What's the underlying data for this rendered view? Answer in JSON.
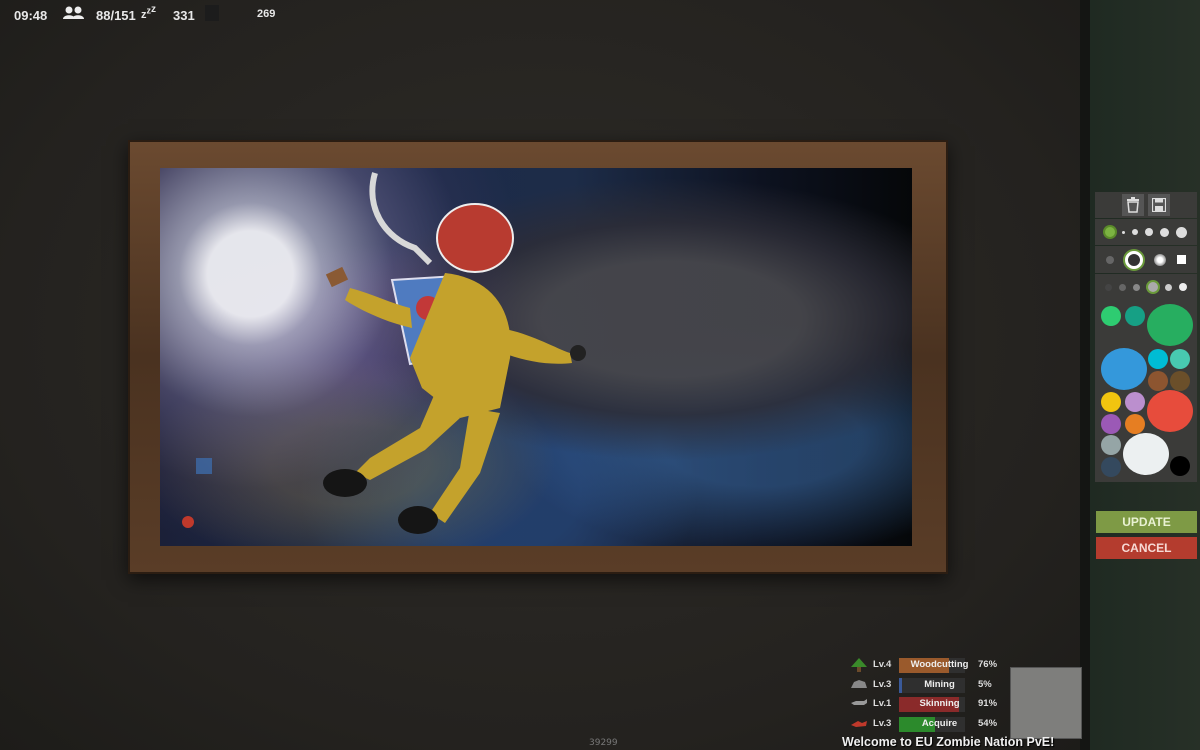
{
  "hud": {
    "time": "09:48",
    "players": "88/151",
    "sleepers_icon": "zzz",
    "sleepers": "331",
    "counter": "269"
  },
  "sign_painter": {
    "tools": {
      "delete_icon": "trash-icon",
      "save_icon": "floppy-disk-icon"
    },
    "update_label": "UPDATE",
    "cancel_label": "CANCEL",
    "colors": {
      "update_bg": "#7e9a45",
      "cancel_bg": "#b43c2e"
    },
    "palette": [
      "#2ecc71",
      "#16a085",
      "#27ae60",
      "#3498db",
      "#00bcd4",
      "#48c9b0",
      "#8d5530",
      "#6b4f2a",
      "#f1c40f",
      "#bb8fce",
      "#e74c3c",
      "#9b59b6",
      "#e67e22",
      "#95a5a6",
      "#ecf0f1",
      "#34495e",
      "#000000"
    ]
  },
  "skills": [
    {
      "level": "Lv.4",
      "name": "Woodcutting",
      "percent": "76%",
      "progress": 0.76,
      "color": "#9a5a2c",
      "icon": "tree-icon"
    },
    {
      "level": "Lv.3",
      "name": "Mining",
      "percent": "5%",
      "progress": 0.05,
      "color": "#3a5a9a",
      "icon": "ore-icon"
    },
    {
      "level": "Lv.1",
      "name": "Skinning",
      "percent": "91%",
      "progress": 0.91,
      "color": "#8a2a2a",
      "icon": "animal-icon"
    },
    {
      "level": "Lv.3",
      "name": "Acquire",
      "percent": "54%",
      "progress": 0.54,
      "color": "#2c8a2c",
      "icon": "hand-icon"
    }
  ],
  "chat": {
    "message": "Welcome to EU Zombie Nation PvE!"
  },
  "footer": {
    "coord": "39299"
  }
}
